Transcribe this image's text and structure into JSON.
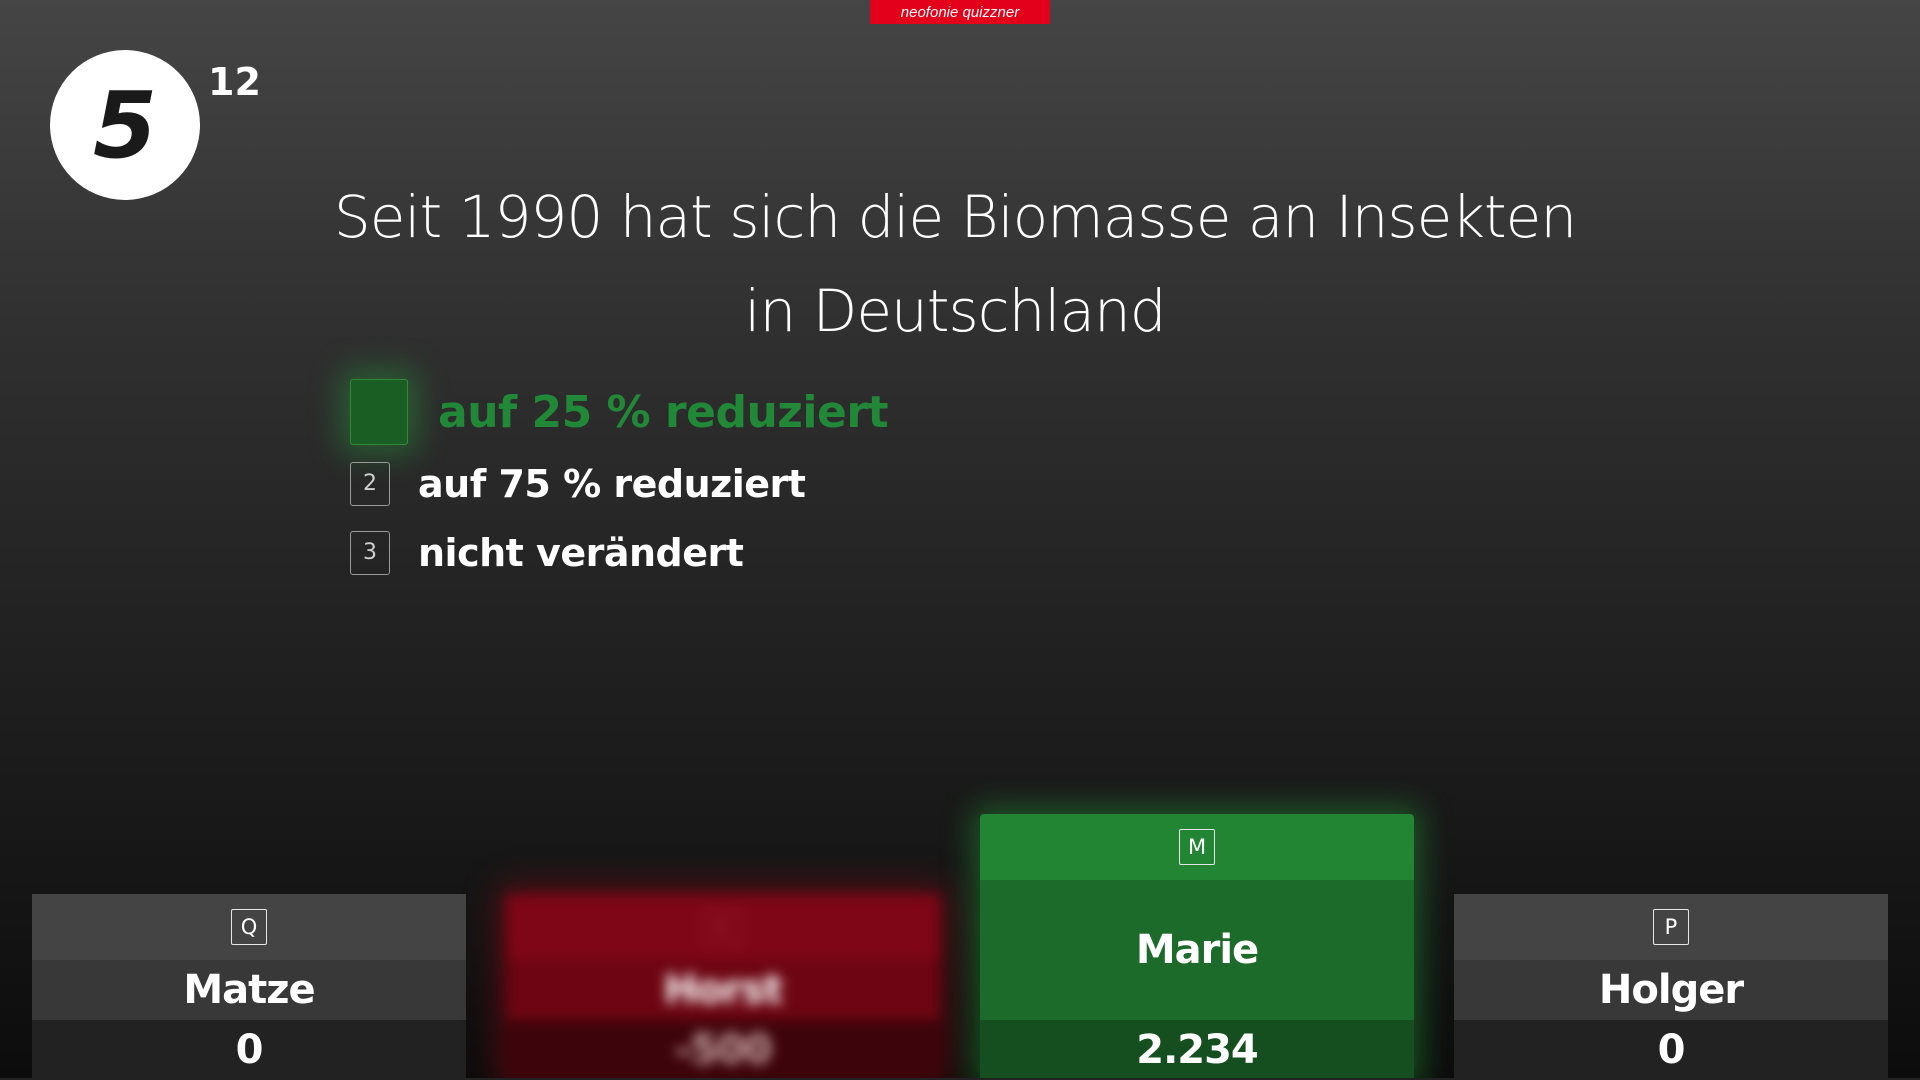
{
  "brand": "neofonie quizzner",
  "round": {
    "current": "5",
    "total": "12"
  },
  "question": {
    "line1": "Seit 1990 hat sich die Biomasse an Insekten",
    "line2": "in Deutschland"
  },
  "answers": [
    {
      "key": "",
      "text": "auf 25 % reduziert",
      "correct": true
    },
    {
      "key": "2",
      "text": "auf 75 % reduziert",
      "correct": false
    },
    {
      "key": "3",
      "text": "nicht verändert",
      "correct": false
    }
  ],
  "players": [
    {
      "key": "Q",
      "name": "Matze",
      "score": "0",
      "state": "neutral"
    },
    {
      "key": "C",
      "name": "Horst",
      "score": "-500",
      "state": "wrong"
    },
    {
      "key": "M",
      "name": "Marie",
      "score": "2.234",
      "state": "correct"
    },
    {
      "key": "P",
      "name": "Holger",
      "score": "0",
      "state": "neutral"
    }
  ],
  "colors": {
    "brand": "#e2001a",
    "correct": "#218838",
    "wrong": "#7e0617",
    "neutral": "#444444"
  }
}
